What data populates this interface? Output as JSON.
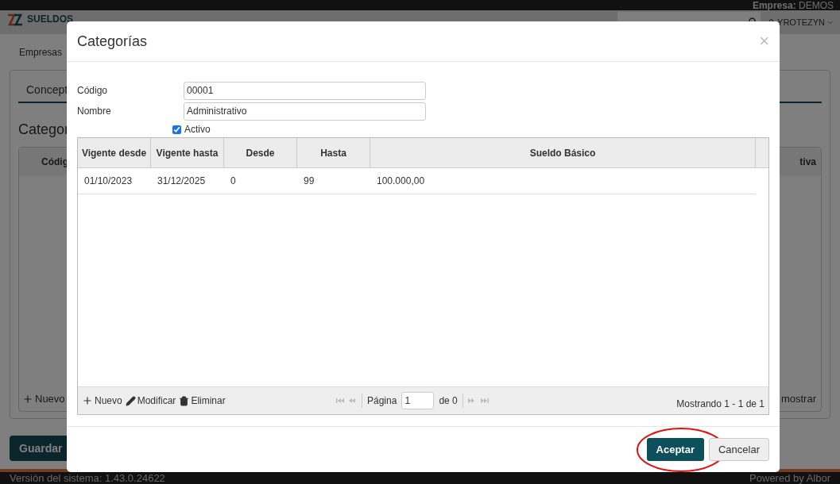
{
  "top_bar": {
    "company_label": "Empresa:",
    "company": "DEMOS"
  },
  "header": {
    "logo": "SUELDOS",
    "user": "YROTEZYN"
  },
  "breadcrumb": "Empresas",
  "tabs": [
    {
      "label": "Concept",
      "selected": true
    }
  ],
  "section_title": "Categor",
  "background_table": {
    "columns": [
      "Códig",
      "tiva"
    ],
    "add_label": "Nuevo",
    "show_label": "mostrar"
  },
  "save_button": "Guardar",
  "footer": {
    "version": "Versión del sistema: 1.43.0.24622",
    "powered": "Powered by Albor"
  },
  "dialog": {
    "title": "Categorías",
    "close": "×",
    "fields": [
      {
        "label": "Código",
        "value": "00001"
      },
      {
        "label": "Nombre",
        "value": "Administrativo"
      }
    ],
    "active": {
      "label": "Activo",
      "checked": true
    },
    "grid": {
      "columns": [
        "Vigente desde",
        "Vigente hasta",
        "Desde",
        "Hasta",
        "Sueldo Básico"
      ],
      "rows": [
        [
          "01/10/2023",
          "31/12/2025",
          "0",
          "99",
          "100.000,00"
        ]
      ],
      "toolbar": [
        {
          "label": "Nuevo",
          "kind": "add"
        },
        {
          "label": "Modificar",
          "kind": "edit"
        },
        {
          "label": "Eliminar",
          "kind": "delete"
        }
      ],
      "pager": {
        "page_label": "Página",
        "page": "1",
        "of": "de 0"
      },
      "summary": "Mostrando 1 - 1 de 1"
    },
    "buttons": [
      {
        "label": "Aceptar",
        "kind": "primary",
        "highlighted": true
      },
      {
        "label": "Cancelar",
        "kind": "secondary",
        "highlighted": false
      }
    ]
  }
}
